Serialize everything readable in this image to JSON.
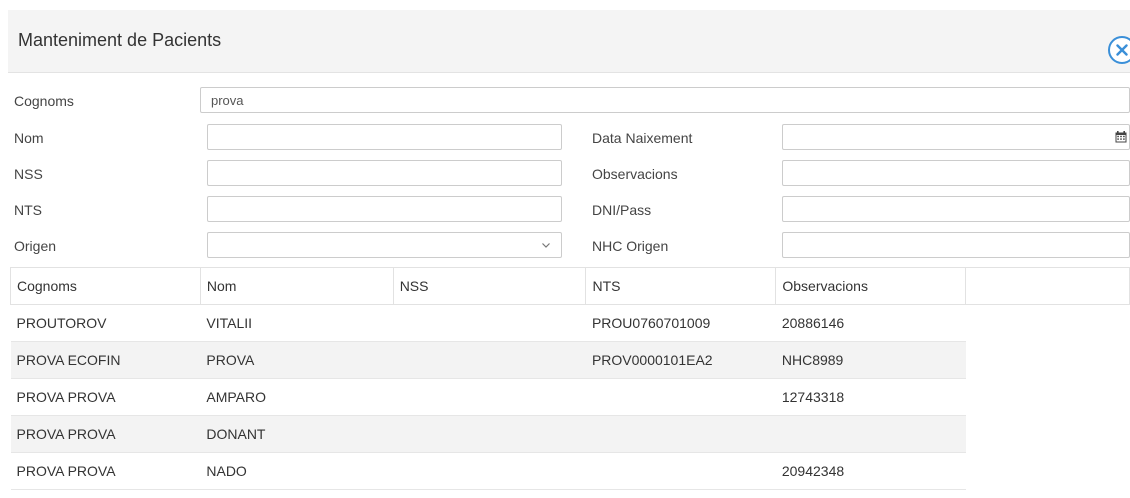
{
  "dialog": {
    "title": "Manteniment de Pacients"
  },
  "form": {
    "cognoms": {
      "label": "Cognoms",
      "value": "prova"
    },
    "nom": {
      "label": "Nom",
      "value": ""
    },
    "nss": {
      "label": "NSS",
      "value": ""
    },
    "nts": {
      "label": "NTS",
      "value": ""
    },
    "origen": {
      "label": "Origen",
      "value": ""
    },
    "data_naixement": {
      "label": "Data Naixement",
      "value": ""
    },
    "observacions": {
      "label": "Observacions",
      "value": ""
    },
    "dni_pass": {
      "label": "DNI/Pass",
      "value": ""
    },
    "nhc_origen": {
      "label": "NHC Origen",
      "value": ""
    }
  },
  "table": {
    "columns": [
      "Cognoms",
      "Nom",
      "NSS",
      "NTS",
      "Observacions"
    ],
    "rows": [
      [
        "PROUTOROV",
        "VITALII",
        "",
        "PROU0760701009",
        "20886146"
      ],
      [
        "PROVA ECOFIN",
        "PROVA",
        "",
        "PROV0000101EA2",
        "NHC8989"
      ],
      [
        "PROVA PROVA",
        "AMPARO",
        "",
        "",
        "12743318"
      ],
      [
        "PROVA PROVA",
        "DONANT",
        "",
        "",
        ""
      ],
      [
        "PROVA PROVA",
        "NADO",
        "",
        "",
        "20942348"
      ]
    ]
  },
  "icons": {
    "close": "close-circle-icon",
    "calendar": "calendar-icon",
    "dropdown": "chevron-down-icon"
  },
  "colors": {
    "accent": "#3a8fd8",
    "header_bg": "#f4f4f4",
    "row_alt": "#f3f3f3"
  }
}
